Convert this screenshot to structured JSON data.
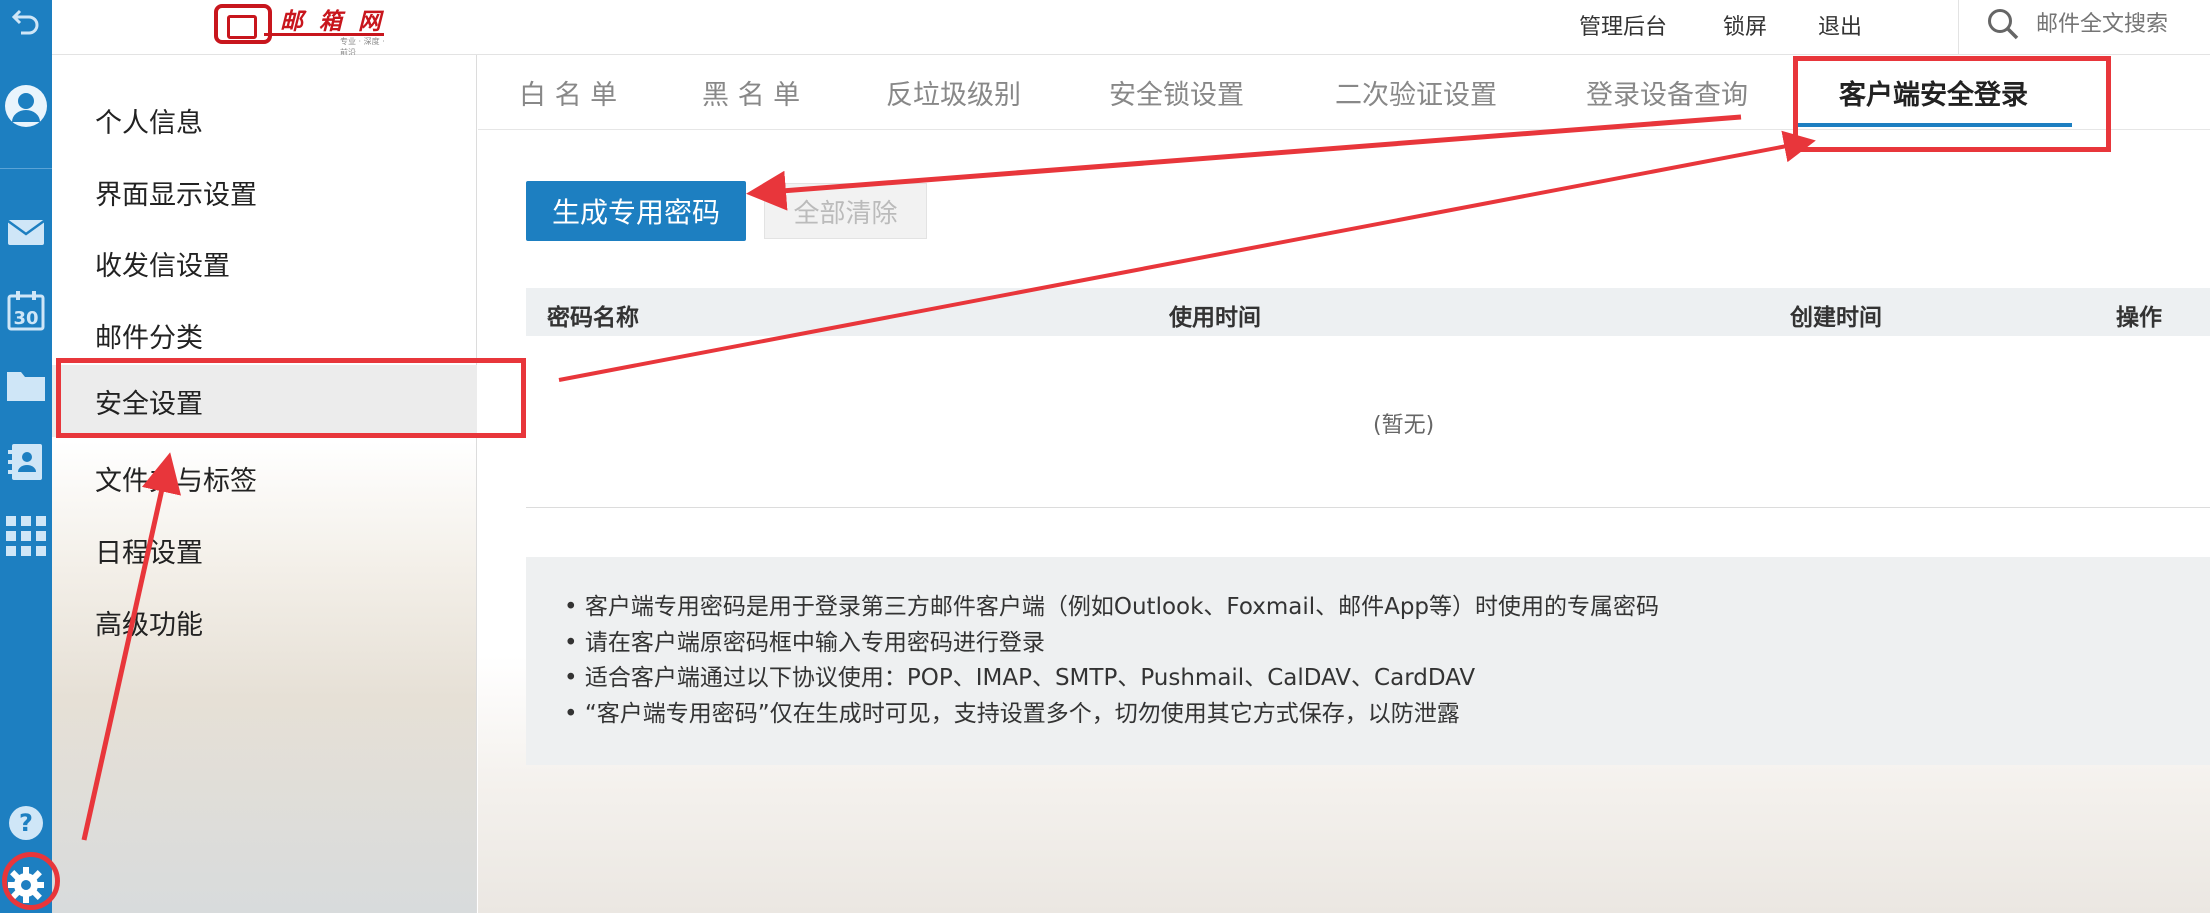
{
  "app": {
    "brand": "邮 箱 网",
    "slogan": "专业 · 深度 · 前沿"
  },
  "topbar": {
    "admin_label": "管理后台",
    "lock_label": "锁屏",
    "logout_label": "退出",
    "search_placeholder": "邮件全文搜索"
  },
  "rail": {
    "icons": [
      "back-icon",
      "avatar-icon",
      "mail-icon",
      "calendar-icon",
      "folder-icon",
      "contacts-icon",
      "apps-grid-icon",
      "help-icon",
      "settings-gear-icon"
    ],
    "calendar_day": "30",
    "help_glyph": "?"
  },
  "sidebar": {
    "items": [
      {
        "label": "个人信息"
      },
      {
        "label": "界面显示设置"
      },
      {
        "label": "收发信设置"
      },
      {
        "label": "邮件分类"
      },
      {
        "label": "安全设置"
      },
      {
        "label": "文件夹与标签"
      },
      {
        "label": "日程设置"
      },
      {
        "label": "高级功能"
      }
    ],
    "active_index": 4
  },
  "main": {
    "tabs": [
      {
        "label": "白 名 单"
      },
      {
        "label": "黑 名 单"
      },
      {
        "label": "反垃圾级别"
      },
      {
        "label": "安全锁设置"
      },
      {
        "label": "二次验证设置"
      },
      {
        "label": "登录设备查询"
      },
      {
        "label": "客户端安全登录"
      }
    ],
    "active_tab": 6,
    "generate_button": "生成专用密码",
    "clear_button": "全部清除",
    "table": {
      "columns": [
        "密码名称",
        "使用时间",
        "创建时间",
        "操作"
      ],
      "empty_text": "(暂无)"
    },
    "notes": [
      "• 客户端专用密码是用于登录第三方邮件客户端（例如Outlook、Foxmail、邮件App等）时使用的专属密码",
      "• 请在客户端原密码框中输入专用密码进行登录",
      "• 适合客户端通过以下协议使用：POP、IMAP、SMTP、Pushmail、CalDAV、CardDAV",
      "• “客户端专用密码”仅在生成时可见，支持设置多个，切勿使用其它方式保存，以防泄露"
    ]
  },
  "colors": {
    "accent": "#1d7fc1",
    "annotation": "#e8363b",
    "brand": "#c8161d"
  }
}
